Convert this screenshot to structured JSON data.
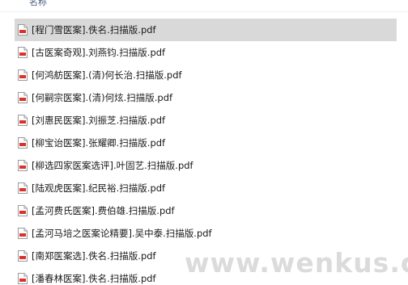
{
  "header": {
    "name_column": "名称"
  },
  "files": [
    {
      "name": "[程门雪医案].佚名.扫描版.pdf",
      "selected": true
    },
    {
      "name": "[古医案奇观].刘燕钧.扫描版.pdf",
      "selected": false
    },
    {
      "name": "[何鸿舫医案].(清)何长治.扫描版.pdf",
      "selected": false
    },
    {
      "name": "[何嗣宗医案].(清)何炫.扫描版.pdf",
      "selected": false
    },
    {
      "name": "[刘惠民医案].刘振芝.扫描版.pdf",
      "selected": false
    },
    {
      "name": "[柳宝诒医案].张耀卿.扫描版.pdf",
      "selected": false
    },
    {
      "name": "[柳选四家医案选评].叶固艺.扫描版.pdf",
      "selected": false
    },
    {
      "name": "[陆观虎医案].纪民裕.扫描版.pdf",
      "selected": false
    },
    {
      "name": "[孟河费氏医案].费伯雄.扫描版.pdf",
      "selected": false
    },
    {
      "name": "[孟河马培之医案论精要].吴中泰.扫描版.pdf",
      "selected": false
    },
    {
      "name": "[南郑医案选].佚名.扫描版.pdf",
      "selected": false
    },
    {
      "name": "[潘春林医案].佚名.扫描版.pdf",
      "selected": false
    }
  ],
  "icon": {
    "name": "pdf-file-icon",
    "accent": "#d9342b"
  },
  "watermark": {
    "text": "www.wenkus.com"
  }
}
